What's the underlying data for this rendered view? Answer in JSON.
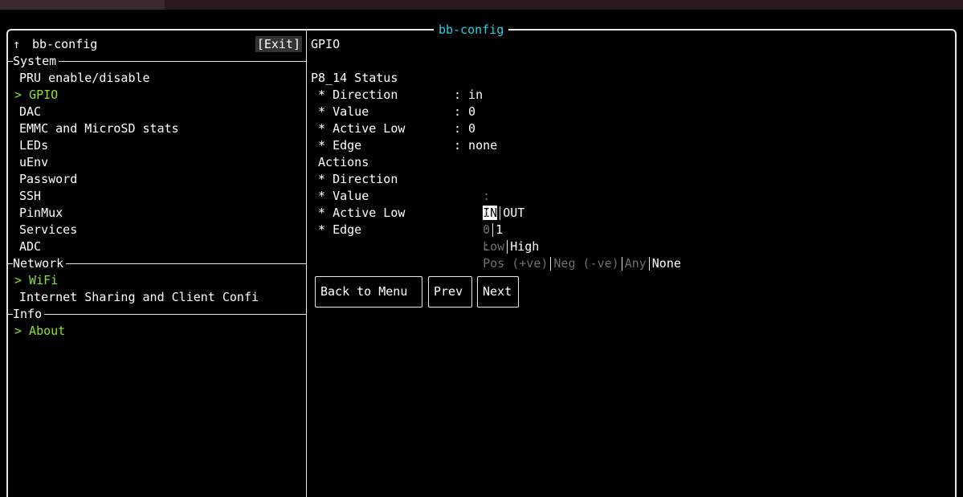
{
  "app_title": "bb-config",
  "colors": {
    "accent": "#8ee52b",
    "title": "#2ad0e8",
    "dim": "#6f6f6f"
  },
  "left": {
    "header_arrow": "↑",
    "header_title": "bb-config",
    "exit_label": "[Exit]",
    "sections": [
      {
        "label": "System"
      },
      {
        "label": "Network"
      },
      {
        "label": "Info"
      }
    ],
    "items": [
      {
        "label": "PRU enable/disable"
      },
      {
        "label": "> GPIO"
      },
      {
        "label": "DAC"
      },
      {
        "label": "EMMC and MicroSD stats"
      },
      {
        "label": "LEDs"
      },
      {
        "label": "uEnv"
      },
      {
        "label": "Password"
      },
      {
        "label": "SSH"
      },
      {
        "label": "PinMux"
      },
      {
        "label": "Services"
      },
      {
        "label": "ADC"
      },
      {
        "label": "> WiFi"
      },
      {
        "label": "Internet Sharing and Client Confi"
      },
      {
        "label": "> About"
      }
    ]
  },
  "right": {
    "header": "GPIO",
    "status_title": "P8_14 Status",
    "status": [
      {
        "label": " * Direction",
        "value": ": in"
      },
      {
        "label": " * Value",
        "value": ": 0"
      },
      {
        "label": " * Active Low",
        "value": ": 0"
      },
      {
        "label": " * Edge",
        "value": ": none"
      }
    ],
    "actions_title": " Actions",
    "actions": [
      {
        "label": " * Direction",
        "colon": ":",
        "options": [
          "IN",
          "OUT"
        ]
      },
      {
        "label": " * Value",
        "colon": ":",
        "options": [
          "0",
          "1"
        ]
      },
      {
        "label": " * Active Low",
        "colon": ":",
        "options": [
          "Low",
          "High"
        ]
      },
      {
        "label": " * Edge",
        "colon": ":",
        "options": [
          "Pos (+ve)",
          "Neg (-ve)",
          "Any",
          "None"
        ]
      }
    ],
    "buttons": {
      "back": "Back to Menu",
      "prev": "Prev",
      "next": "Next"
    }
  }
}
